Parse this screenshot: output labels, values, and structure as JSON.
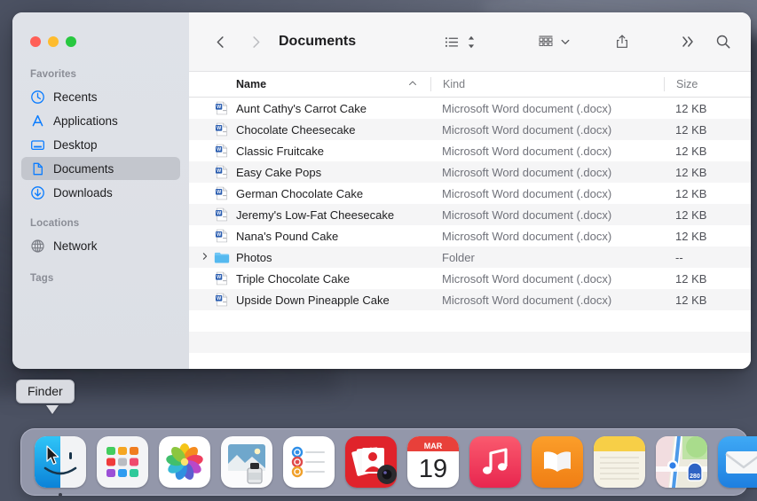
{
  "window": {
    "title": "Documents",
    "traffic_lights": [
      {
        "name": "close",
        "color": "#ff5f57"
      },
      {
        "name": "minimize",
        "color": "#febc2e"
      },
      {
        "name": "maximize",
        "color": "#28c840"
      }
    ]
  },
  "toolbar": {
    "back_icon": "chevron-left-icon",
    "forward_icon": "chevron-right-icon",
    "title": "Documents",
    "view_list_icon": "list-view-icon",
    "view_sort_icon": "sort-updown-icon",
    "group_icon": "group-view-icon",
    "group_chevron_icon": "chevron-down-icon",
    "share_icon": "share-icon",
    "more_icon": "more-chevrons-icon",
    "search_icon": "search-icon"
  },
  "sidebar": {
    "sections": [
      {
        "title": "Favorites",
        "items": [
          {
            "label": "Recents",
            "icon": "clock-icon",
            "selected": false
          },
          {
            "label": "Applications",
            "icon": "applications-icon",
            "selected": false
          },
          {
            "label": "Desktop",
            "icon": "desktop-icon",
            "selected": false
          },
          {
            "label": "Documents",
            "icon": "document-icon",
            "selected": true
          },
          {
            "label": "Downloads",
            "icon": "download-icon",
            "selected": false
          }
        ]
      },
      {
        "title": "Locations",
        "items": [
          {
            "label": "Network",
            "icon": "globe-icon",
            "selected": false
          }
        ]
      },
      {
        "title": "Tags",
        "items": []
      }
    ]
  },
  "columns": {
    "name": "Name",
    "kind": "Kind",
    "size": "Size",
    "sort_arrow": "chevron-up-icon"
  },
  "files": [
    {
      "name": "Aunt Cathy's Carrot Cake",
      "icon": "word-document-icon",
      "kind": "Microsoft Word document (.docx)",
      "size": "12 KB",
      "expandable": false
    },
    {
      "name": "Chocolate Cheesecake",
      "icon": "word-document-icon",
      "kind": "Microsoft Word document (.docx)",
      "size": "12 KB",
      "expandable": false
    },
    {
      "name": "Classic Fruitcake",
      "icon": "word-document-icon",
      "kind": "Microsoft Word document (.docx)",
      "size": "12 KB",
      "expandable": false
    },
    {
      "name": "Easy Cake Pops",
      "icon": "word-document-icon",
      "kind": "Microsoft Word document (.docx)",
      "size": "12 KB",
      "expandable": false
    },
    {
      "name": "German Chocolate Cake",
      "icon": "word-document-icon",
      "kind": "Microsoft Word document (.docx)",
      "size": "12 KB",
      "expandable": false
    },
    {
      "name": "Jeremy's Low-Fat Cheesecake",
      "icon": "word-document-icon",
      "kind": "Microsoft Word document (.docx)",
      "size": "12 KB",
      "expandable": false
    },
    {
      "name": "Nana's Pound Cake",
      "icon": "word-document-icon",
      "kind": "Microsoft Word document (.docx)",
      "size": "12 KB",
      "expandable": false
    },
    {
      "name": "Photos",
      "icon": "folder-icon",
      "kind": "Folder",
      "size": "--",
      "expandable": true
    },
    {
      "name": "Triple Chocolate Cake",
      "icon": "word-document-icon",
      "kind": "Microsoft Word document (.docx)",
      "size": "12 KB",
      "expandable": false
    },
    {
      "name": "Upside Down Pineapple Cake",
      "icon": "word-document-icon",
      "kind": "Microsoft Word document (.docx)",
      "size": "12 KB",
      "expandable": false
    }
  ],
  "tooltip": {
    "label": "Finder"
  },
  "dock": {
    "items": [
      {
        "name": "Finder",
        "icon": "finder-icon",
        "running": true
      },
      {
        "name": "Launchpad",
        "icon": "launchpad-icon",
        "running": false
      },
      {
        "name": "Photos",
        "icon": "photos-icon",
        "running": false
      },
      {
        "name": "Preview",
        "icon": "preview-icon",
        "running": false
      },
      {
        "name": "Reminders",
        "icon": "reminders-icon",
        "running": false
      },
      {
        "name": "Photo Booth",
        "icon": "photobooth-icon",
        "running": false
      },
      {
        "name": "Calendar",
        "icon": "calendar-icon",
        "running": false,
        "month": "MAR",
        "day": "19"
      },
      {
        "name": "Music",
        "icon": "music-icon",
        "running": false
      },
      {
        "name": "Books",
        "icon": "books-icon",
        "running": false
      },
      {
        "name": "Notes",
        "icon": "notes-icon",
        "running": false
      },
      {
        "name": "Maps",
        "icon": "maps-icon",
        "running": false,
        "shield": "280"
      },
      {
        "name": "Mail",
        "icon": "mail-icon",
        "running": false
      }
    ]
  },
  "colors": {
    "accent_blue": "#0a7cff",
    "sidebar_bg": "#dde0e6",
    "selection": "#c3c6cd",
    "row_alt": "#f5f5f6"
  }
}
